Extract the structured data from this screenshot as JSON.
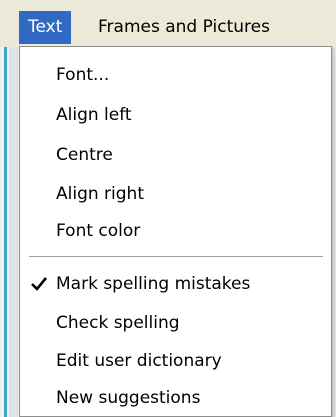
{
  "menubar": {
    "items": [
      {
        "label": "Text",
        "active": true
      },
      {
        "label": "Frames and Pictures",
        "active": false
      }
    ]
  },
  "menu": {
    "group1": [
      {
        "label": "Font..."
      },
      {
        "label": "Align left"
      },
      {
        "label": "Centre"
      },
      {
        "label": "Align right"
      },
      {
        "label": "Font color"
      }
    ],
    "group2": [
      {
        "label": "Mark spelling mistakes",
        "checked": true
      },
      {
        "label": "Check spelling"
      },
      {
        "label": "Edit user dictionary"
      },
      {
        "label": "New suggestions"
      }
    ]
  },
  "colors": {
    "highlight": "#316ac5",
    "menubar_bg": "#ece9d8",
    "menu_bg": "#ffffff"
  },
  "icons": {
    "check": "check-icon"
  }
}
